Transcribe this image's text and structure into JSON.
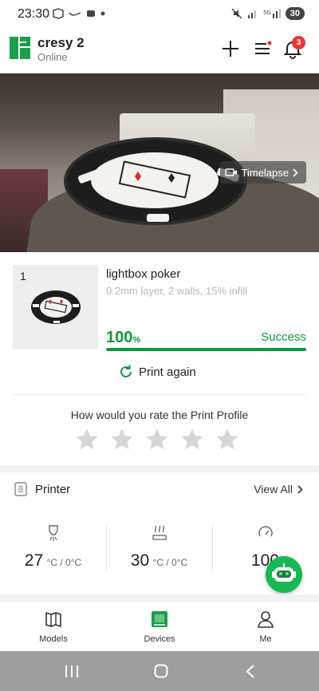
{
  "status_bar": {
    "time": "23:30",
    "battery": "30"
  },
  "header": {
    "device_name": "cresy 2",
    "device_status": "Online",
    "notification_count": "3"
  },
  "camera": {
    "timelapse_label": "Timelapse"
  },
  "job": {
    "index": "1",
    "title": "lightbox poker",
    "details": "0.2mm layer, 2 walls, 15% infill",
    "progress_value": "100",
    "progress_unit": "%",
    "progress_fraction": 1.0,
    "status": "Success",
    "print_again_label": "Print again"
  },
  "rating": {
    "title": "How would you rate the Print Profile",
    "stars": 5,
    "filled": 0
  },
  "printer_section": {
    "title": "Printer",
    "view_all_label": "View All",
    "stats": [
      {
        "icon": "nozzle-temp-icon",
        "value": "27",
        "unit": "°C / 0°C"
      },
      {
        "icon": "heatbed-temp-icon",
        "value": "30",
        "unit": "°C / 0°C"
      },
      {
        "icon": "speed-gauge-icon",
        "value": "100",
        "unit": ""
      }
    ]
  },
  "bottom_nav": [
    {
      "label": "Models",
      "icon": "models-icon",
      "active": false
    },
    {
      "label": "Devices",
      "icon": "devices-icon",
      "active": true
    },
    {
      "label": "Me",
      "icon": "me-icon",
      "active": false
    }
  ],
  "colors": {
    "accent": "#0c9a3e",
    "badge": "#e33333",
    "muted": "#b8b8b8"
  }
}
